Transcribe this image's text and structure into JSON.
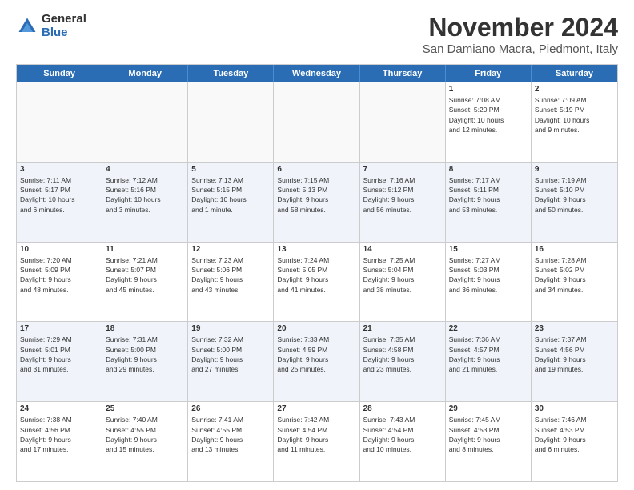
{
  "logo": {
    "general": "General",
    "blue": "Blue"
  },
  "title": "November 2024",
  "subtitle": "San Damiano Macra, Piedmont, Italy",
  "headers": [
    "Sunday",
    "Monday",
    "Tuesday",
    "Wednesday",
    "Thursday",
    "Friday",
    "Saturday"
  ],
  "weeks": [
    [
      {
        "day": "",
        "info": ""
      },
      {
        "day": "",
        "info": ""
      },
      {
        "day": "",
        "info": ""
      },
      {
        "day": "",
        "info": ""
      },
      {
        "day": "",
        "info": ""
      },
      {
        "day": "1",
        "info": "Sunrise: 7:08 AM\nSunset: 5:20 PM\nDaylight: 10 hours\nand 12 minutes."
      },
      {
        "day": "2",
        "info": "Sunrise: 7:09 AM\nSunset: 5:19 PM\nDaylight: 10 hours\nand 9 minutes."
      }
    ],
    [
      {
        "day": "3",
        "info": "Sunrise: 7:11 AM\nSunset: 5:17 PM\nDaylight: 10 hours\nand 6 minutes."
      },
      {
        "day": "4",
        "info": "Sunrise: 7:12 AM\nSunset: 5:16 PM\nDaylight: 10 hours\nand 3 minutes."
      },
      {
        "day": "5",
        "info": "Sunrise: 7:13 AM\nSunset: 5:15 PM\nDaylight: 10 hours\nand 1 minute."
      },
      {
        "day": "6",
        "info": "Sunrise: 7:15 AM\nSunset: 5:13 PM\nDaylight: 9 hours\nand 58 minutes."
      },
      {
        "day": "7",
        "info": "Sunrise: 7:16 AM\nSunset: 5:12 PM\nDaylight: 9 hours\nand 56 minutes."
      },
      {
        "day": "8",
        "info": "Sunrise: 7:17 AM\nSunset: 5:11 PM\nDaylight: 9 hours\nand 53 minutes."
      },
      {
        "day": "9",
        "info": "Sunrise: 7:19 AM\nSunset: 5:10 PM\nDaylight: 9 hours\nand 50 minutes."
      }
    ],
    [
      {
        "day": "10",
        "info": "Sunrise: 7:20 AM\nSunset: 5:09 PM\nDaylight: 9 hours\nand 48 minutes."
      },
      {
        "day": "11",
        "info": "Sunrise: 7:21 AM\nSunset: 5:07 PM\nDaylight: 9 hours\nand 45 minutes."
      },
      {
        "day": "12",
        "info": "Sunrise: 7:23 AM\nSunset: 5:06 PM\nDaylight: 9 hours\nand 43 minutes."
      },
      {
        "day": "13",
        "info": "Sunrise: 7:24 AM\nSunset: 5:05 PM\nDaylight: 9 hours\nand 41 minutes."
      },
      {
        "day": "14",
        "info": "Sunrise: 7:25 AM\nSunset: 5:04 PM\nDaylight: 9 hours\nand 38 minutes."
      },
      {
        "day": "15",
        "info": "Sunrise: 7:27 AM\nSunset: 5:03 PM\nDaylight: 9 hours\nand 36 minutes."
      },
      {
        "day": "16",
        "info": "Sunrise: 7:28 AM\nSunset: 5:02 PM\nDaylight: 9 hours\nand 34 minutes."
      }
    ],
    [
      {
        "day": "17",
        "info": "Sunrise: 7:29 AM\nSunset: 5:01 PM\nDaylight: 9 hours\nand 31 minutes."
      },
      {
        "day": "18",
        "info": "Sunrise: 7:31 AM\nSunset: 5:00 PM\nDaylight: 9 hours\nand 29 minutes."
      },
      {
        "day": "19",
        "info": "Sunrise: 7:32 AM\nSunset: 5:00 PM\nDaylight: 9 hours\nand 27 minutes."
      },
      {
        "day": "20",
        "info": "Sunrise: 7:33 AM\nSunset: 4:59 PM\nDaylight: 9 hours\nand 25 minutes."
      },
      {
        "day": "21",
        "info": "Sunrise: 7:35 AM\nSunset: 4:58 PM\nDaylight: 9 hours\nand 23 minutes."
      },
      {
        "day": "22",
        "info": "Sunrise: 7:36 AM\nSunset: 4:57 PM\nDaylight: 9 hours\nand 21 minutes."
      },
      {
        "day": "23",
        "info": "Sunrise: 7:37 AM\nSunset: 4:56 PM\nDaylight: 9 hours\nand 19 minutes."
      }
    ],
    [
      {
        "day": "24",
        "info": "Sunrise: 7:38 AM\nSunset: 4:56 PM\nDaylight: 9 hours\nand 17 minutes."
      },
      {
        "day": "25",
        "info": "Sunrise: 7:40 AM\nSunset: 4:55 PM\nDaylight: 9 hours\nand 15 minutes."
      },
      {
        "day": "26",
        "info": "Sunrise: 7:41 AM\nSunset: 4:55 PM\nDaylight: 9 hours\nand 13 minutes."
      },
      {
        "day": "27",
        "info": "Sunrise: 7:42 AM\nSunset: 4:54 PM\nDaylight: 9 hours\nand 11 minutes."
      },
      {
        "day": "28",
        "info": "Sunrise: 7:43 AM\nSunset: 4:54 PM\nDaylight: 9 hours\nand 10 minutes."
      },
      {
        "day": "29",
        "info": "Sunrise: 7:45 AM\nSunset: 4:53 PM\nDaylight: 9 hours\nand 8 minutes."
      },
      {
        "day": "30",
        "info": "Sunrise: 7:46 AM\nSunset: 4:53 PM\nDaylight: 9 hours\nand 6 minutes."
      }
    ]
  ]
}
